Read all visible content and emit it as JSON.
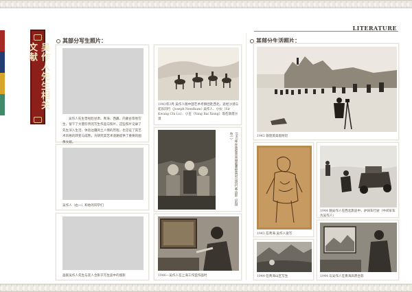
{
  "header": {
    "section_label": "LITERATURE"
  },
  "banner": {
    "title": "吴作人先生相关文献"
  },
  "side_tabs": [
    {
      "color": "#a62a24"
    },
    {
      "color": "#233d73"
    },
    {
      "color": "#d7a52b"
    },
    {
      "color": "#3e8a6a"
    }
  ],
  "left": {
    "heading": "其部分写生照片：",
    "intro": "吴作人先生曾经赴甘肃、青海、西藏、内蒙古等地写生，留下了大量珍贵的写生作品与照片。这些照片记录了先生深入生活、体验边疆风土人情的历程，也见证了其艺术风格的转变与成熟，为研究其艺术道路提供了重要的图像文献。",
    "captions": {
      "c1": "吴作人（右一）和他的同学们",
      "c2": "画家吴作人先生与友人合影于写生途中的留影",
      "camels": "1943年3月·吴作人随中国艺术考察团赴西北，途经沙漠与驼队同行（Joseph Needham）·吴作人、小伙（Sir Kwang Chi Lu）、小王（Yang Bai Xiang）等在敦煌沙漠",
      "group_vertical": "1943年在敦煌莫高窟临摹壁画时与同行者合影（前排右一）",
      "studio": "1946—吴作人在上海工作室作画时"
    }
  },
  "right": {
    "heading": "其部分生活照片：",
    "captions": {
      "survey": "1943 敦煌莫高窟附近",
      "sketch": "1943 在青海 吴作人速写",
      "jeep": "1944 随吴作人在西北旅途中，驴骑车行驶（中间军车为吴作人）",
      "mountains": "1944·在青海山区写生",
      "portrait": "1944·与吴作人在青海高原合影"
    }
  }
}
